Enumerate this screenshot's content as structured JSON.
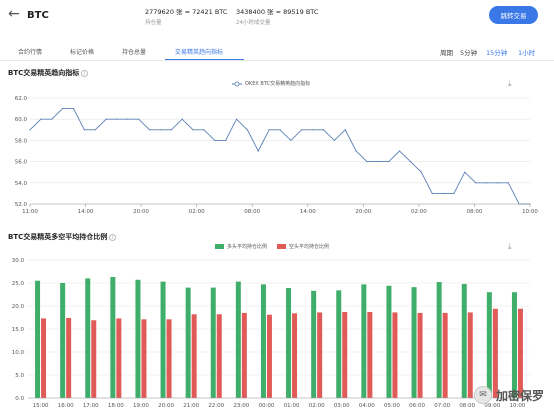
{
  "header": {
    "back_glyph": "←",
    "title": "BTC",
    "open_interest_value": "2779620 张 ≈ 72421 BTC",
    "open_interest_label": "持仓量",
    "volume_value": "3438400 张 ≈ 89519 BTC",
    "volume_label": "24小时成交量",
    "trade_button": "跳转交易"
  },
  "tabs": [
    {
      "label": "合约行情"
    },
    {
      "label": "标记价格"
    },
    {
      "label": "持仓总量"
    },
    {
      "label": "交易精英趋向指标",
      "active": true
    }
  ],
  "period": {
    "label": "周期",
    "options": [
      "5分钟",
      "15分钟",
      "1小时"
    ],
    "selected": "5分钟"
  },
  "chart1": {
    "title": "BTC交易精英趋向指标",
    "legend": "OKEX BTC交易精英趋向指标"
  },
  "chart2": {
    "title": "BTC交易精英多空平均持仓比例",
    "legend_long": "多头平均持仓比例",
    "legend_short": "空头平均持仓比例"
  },
  "watermark": "加密保罗",
  "colors": {
    "accent": "#3a78e8",
    "line": "#5a7fb5",
    "long_bar": "#3fae6a",
    "short_bar": "#e05a57"
  },
  "chart_data": [
    {
      "type": "line",
      "title": "BTC交易精英趋向指标",
      "series": [
        {
          "name": "OKEX BTC交易精英趋向指标",
          "values": [
            59,
            60,
            60,
            61,
            61,
            59,
            59,
            60,
            60,
            60,
            60,
            59,
            59,
            59,
            60,
            59,
            59,
            58,
            58,
            60,
            59,
            57,
            59,
            59,
            58,
            59,
            59,
            59,
            58,
            59,
            57,
            56,
            56,
            56,
            57,
            56,
            55,
            53,
            53,
            53,
            55,
            54,
            54,
            54,
            54,
            52,
            52
          ]
        }
      ],
      "x_ticks": [
        "11:00",
        "14:00",
        "20:00",
        "02:00",
        "08:00",
        "14:00",
        "20:00",
        "02:00",
        "08:00",
        "10:00"
      ],
      "ylim": [
        52,
        62
      ],
      "y_ticks": [
        "52.0",
        "54.0",
        "56.0",
        "58.0",
        "60.0",
        "62.0"
      ],
      "grid": true,
      "legend": "top-center"
    },
    {
      "type": "bar",
      "title": "BTC交易精英多空平均持仓比例",
      "categories": [
        "15:00",
        "16:00",
        "17:00",
        "18:00",
        "19:00",
        "20:00",
        "21:00",
        "22:00",
        "23:00",
        "00:00",
        "01:00",
        "02:00",
        "03:00",
        "04:00",
        "05:00",
        "06:00",
        "07:00",
        "08:00",
        "09:00",
        "10:00"
      ],
      "series": [
        {
          "name": "多头平均持仓比例",
          "values": [
            25.5,
            25.0,
            26.0,
            26.3,
            25.7,
            25.3,
            24.0,
            24.0,
            25.3,
            24.7,
            23.9,
            23.3,
            23.4,
            24.7,
            24.4,
            24.1,
            25.2,
            24.8,
            23.0,
            23.0
          ]
        },
        {
          "name": "空头平均持仓比例",
          "values": [
            17.3,
            17.4,
            16.9,
            17.3,
            17.1,
            17.1,
            18.2,
            18.2,
            18.5,
            18.1,
            18.4,
            18.6,
            18.7,
            18.7,
            18.6,
            18.5,
            18.5,
            18.6,
            19.4,
            19.4
          ]
        }
      ],
      "ylim": [
        0,
        30
      ],
      "y_ticks": [
        "0.0",
        "5.0",
        "10.0",
        "15.0",
        "20.0",
        "25.0",
        "30.0"
      ],
      "grid": true,
      "legend": "top-center"
    }
  ]
}
